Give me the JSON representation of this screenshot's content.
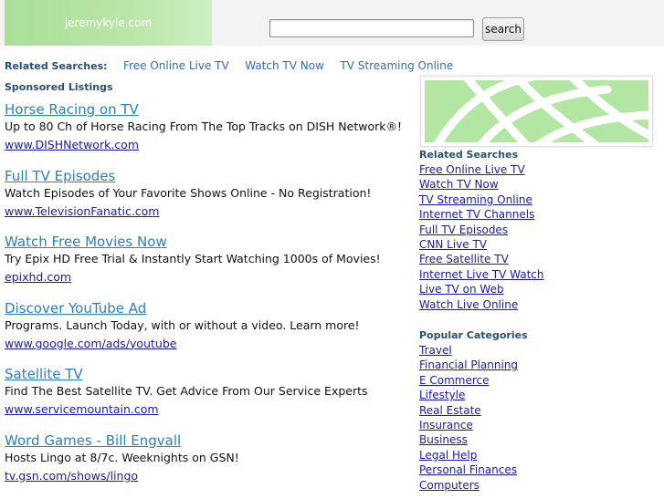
{
  "header": {
    "site_name": "jeremykyle.com",
    "search_placeholder": "",
    "search_button": "search"
  },
  "related_top": {
    "label": "Related Searches:",
    "links": [
      "Free Online Live TV",
      "Watch TV Now",
      "TV Streaming Online"
    ]
  },
  "sponsored_label": "Sponsored Listings",
  "listings": [
    {
      "title": "Horse Racing on TV",
      "desc": "Up to 80 Ch of Horse Racing From The Top Tracks on DISH Network®!",
      "url": "www.DISHNetwork.com"
    },
    {
      "title": "Full TV Episodes",
      "desc": "Watch Episodes of Your Favorite Shows Online - No Registration!",
      "url": "www.TelevisionFanatic.com"
    },
    {
      "title": "Watch Free Movies Now",
      "desc": "Try Epix HD Free Trial & Instantly Start Watching 1000s of Movies!",
      "url": "epixhd.com"
    },
    {
      "title": "Discover YouTube Ad",
      "desc": "Programs. Launch Today, with or without a video. Learn more!",
      "url": "www.google.com/ads/youtube"
    },
    {
      "title": "Satellite TV",
      "desc": "Find The Best Satellite TV. Get Advice From Our Service Experts",
      "url": "www.servicemountain.com"
    },
    {
      "title": "Word Games - Bill Engvall",
      "desc": "Hosts Lingo at 8/7c. Weeknights on GSN!",
      "url": "tv.gsn.com/shows/lingo"
    }
  ],
  "side_related": {
    "heading": "Related Searches",
    "links": [
      "Free Online Live TV",
      "Watch TV Now",
      "TV Streaming Online",
      "Internet TV Channels",
      "Full TV Episodes",
      "CNN Live TV",
      "Free Satellite TV",
      "Internet Live TV Watch",
      "Live TV on Web",
      "Watch Live Online"
    ]
  },
  "side_popular": {
    "heading": "Popular Categories",
    "links": [
      "Travel",
      "Financial Planning",
      "E Commerce",
      "Lifestyle",
      "Real Estate",
      "Insurance",
      "Business",
      "Legal Help",
      "Personal Finances",
      "Computers"
    ]
  }
}
